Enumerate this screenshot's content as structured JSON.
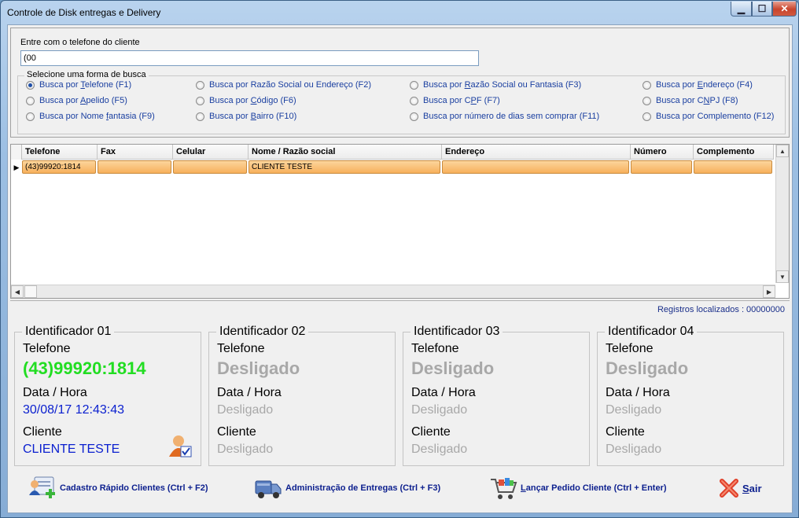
{
  "window": {
    "title": "Controle de Disk entregas e Delivery"
  },
  "search": {
    "phone_label": "Entre com o telefone do cliente",
    "phone_value": "(00",
    "group_title": "Selecione uma forma de busca",
    "options": [
      {
        "pre": "Busca por ",
        "key": "T",
        "post": "elefone (F1)",
        "checked": true
      },
      {
        "pre": "Busca por Razão Social ou Endereço (F2)",
        "key": "",
        "post": "",
        "checked": false
      },
      {
        "pre": "Busca por ",
        "key": "R",
        "post": "azão Social ou Fantasia (F3)",
        "checked": false
      },
      {
        "pre": "Busca por ",
        "key": "E",
        "post": "ndereço (F4)",
        "checked": false
      },
      {
        "pre": "Busca por ",
        "key": "A",
        "post": "pelido (F5)",
        "checked": false
      },
      {
        "pre": "Busca por ",
        "key": "C",
        "post": "ódigo (F6)",
        "checked": false
      },
      {
        "pre": "Busca por C",
        "key": "P",
        "post": "F (F7)",
        "checked": false
      },
      {
        "pre": "Busca por C",
        "key": "N",
        "post": "PJ (F8)",
        "checked": false
      },
      {
        "pre": "Busca por Nome ",
        "key": "f",
        "post": "antasia (F9)",
        "checked": false
      },
      {
        "pre": "Busca por ",
        "key": "B",
        "post": "airro (F10)",
        "checked": false
      },
      {
        "pre": "Busca por número de dias sem comprar (F11)",
        "key": "",
        "post": "",
        "checked": false
      },
      {
        "pre": "Busca por Complemento (F12)",
        "key": "",
        "post": "",
        "checked": false
      }
    ]
  },
  "grid": {
    "columns": [
      "Telefone",
      "Fax",
      "Celular",
      "Nome / Razão social",
      "Endereço",
      "Número",
      "Complemento"
    ],
    "rows": [
      [
        "(43)99920:1814",
        "",
        "",
        "CLIENTE TESTE",
        "",
        "",
        ""
      ]
    ],
    "row_indicator": "▶"
  },
  "registros": "Registros localizados : 00000000",
  "identificadores": [
    {
      "title": "Identificador 01",
      "tel_label": "Telefone",
      "tel": "(43)99920:1814",
      "dh_label": "Data / Hora",
      "dh": "30/08/17 12:43:43",
      "cli_label": "Cliente",
      "cli": "CLIENTE TESTE",
      "active": true
    },
    {
      "title": "Identificador 02",
      "tel_label": "Telefone",
      "tel": "Desligado",
      "dh_label": "Data / Hora",
      "dh": "Desligado",
      "cli_label": "Cliente",
      "cli": "Desligado",
      "active": false
    },
    {
      "title": "Identificador 03",
      "tel_label": "Telefone",
      "tel": "Desligado",
      "dh_label": "Data / Hora",
      "dh": "Desligado",
      "cli_label": "Cliente",
      "cli": "Desligado",
      "active": false
    },
    {
      "title": "Identificador 04",
      "tel_label": "Telefone",
      "tel": "Desligado",
      "dh_label": "Data / Hora",
      "dh": "Desligado",
      "cli_label": "Cliente",
      "cli": "Desligado",
      "active": false
    }
  ],
  "actions": {
    "cadastro": "Cadastro Rápido Clientes (Ctrl + F2)",
    "admin": "Administração de Entregas (Ctrl + F3)",
    "lancar_key": "L",
    "lancar_rest": "ançar Pedido Cliente (Ctrl + Enter)",
    "sair_key": "S",
    "sair_rest": "air"
  },
  "colors": {
    "active_phone": "#22dd22",
    "active_text": "#0a1fcf",
    "inactive_text": "#a8a8a8",
    "row_highlight": "#f7b05c"
  },
  "icons": [
    "cliente-check-icon",
    "add-client-icon",
    "delivery-truck-icon",
    "shopping-cart-icon",
    "close-x-icon"
  ]
}
